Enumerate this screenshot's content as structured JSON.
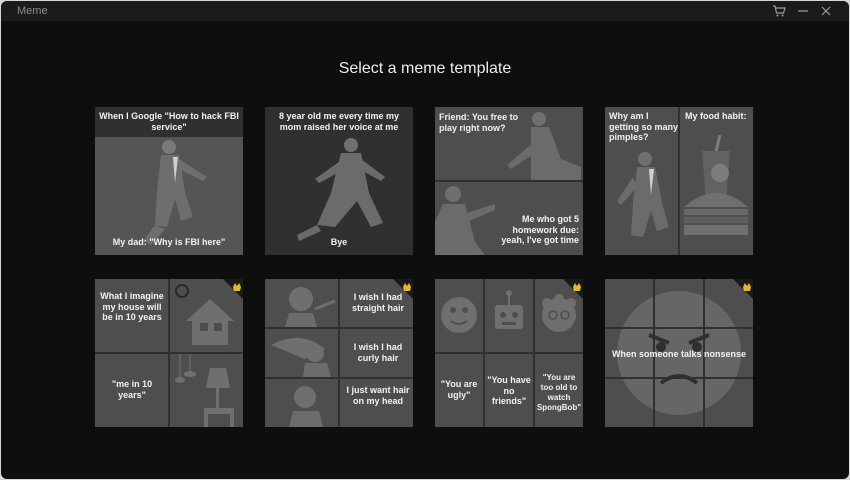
{
  "app": {
    "title": "Meme"
  },
  "heading": "Select a meme template",
  "templates": [
    {
      "top": "When I Google \"How to hack FBI service\"",
      "bottom": "My dad: \"Why is FBI here\""
    },
    {
      "top": "8 year old me every time my mom raised her voice at me",
      "bottom": "Bye"
    },
    {
      "top": "Friend: You free to play right now?",
      "bottom": "Me who got 5 homework due: yeah, I've got time"
    },
    {
      "left": "Why am I getting so many pimples?",
      "right": "My food habit:"
    },
    {
      "top": "What I imagine my house will be in 10 years",
      "bottom": "\"me in 10 years\"",
      "premium": true
    },
    {
      "p1": "I wish I had straight hair",
      "p2": "I wish I had curly hair",
      "p3": "I just want hair on my head",
      "premium": true
    },
    {
      "c1": "\"You are ugly\"",
      "c2": "\"You have no friends\"",
      "c3": "\"You are too old to watch SpongBob\"",
      "premium": true
    },
    {
      "caption": "When someone talks nonsense",
      "premium": true
    }
  ],
  "colors": {
    "background": "#0e0e0e",
    "tile": "#303030",
    "panel": "#4e4e4e",
    "figure": "#6f6f6f",
    "premium": "#e8b722"
  },
  "icons": {
    "cart": "cart-icon",
    "minimize": "minimize-icon",
    "close": "close-icon",
    "premium": "crown-icon"
  }
}
